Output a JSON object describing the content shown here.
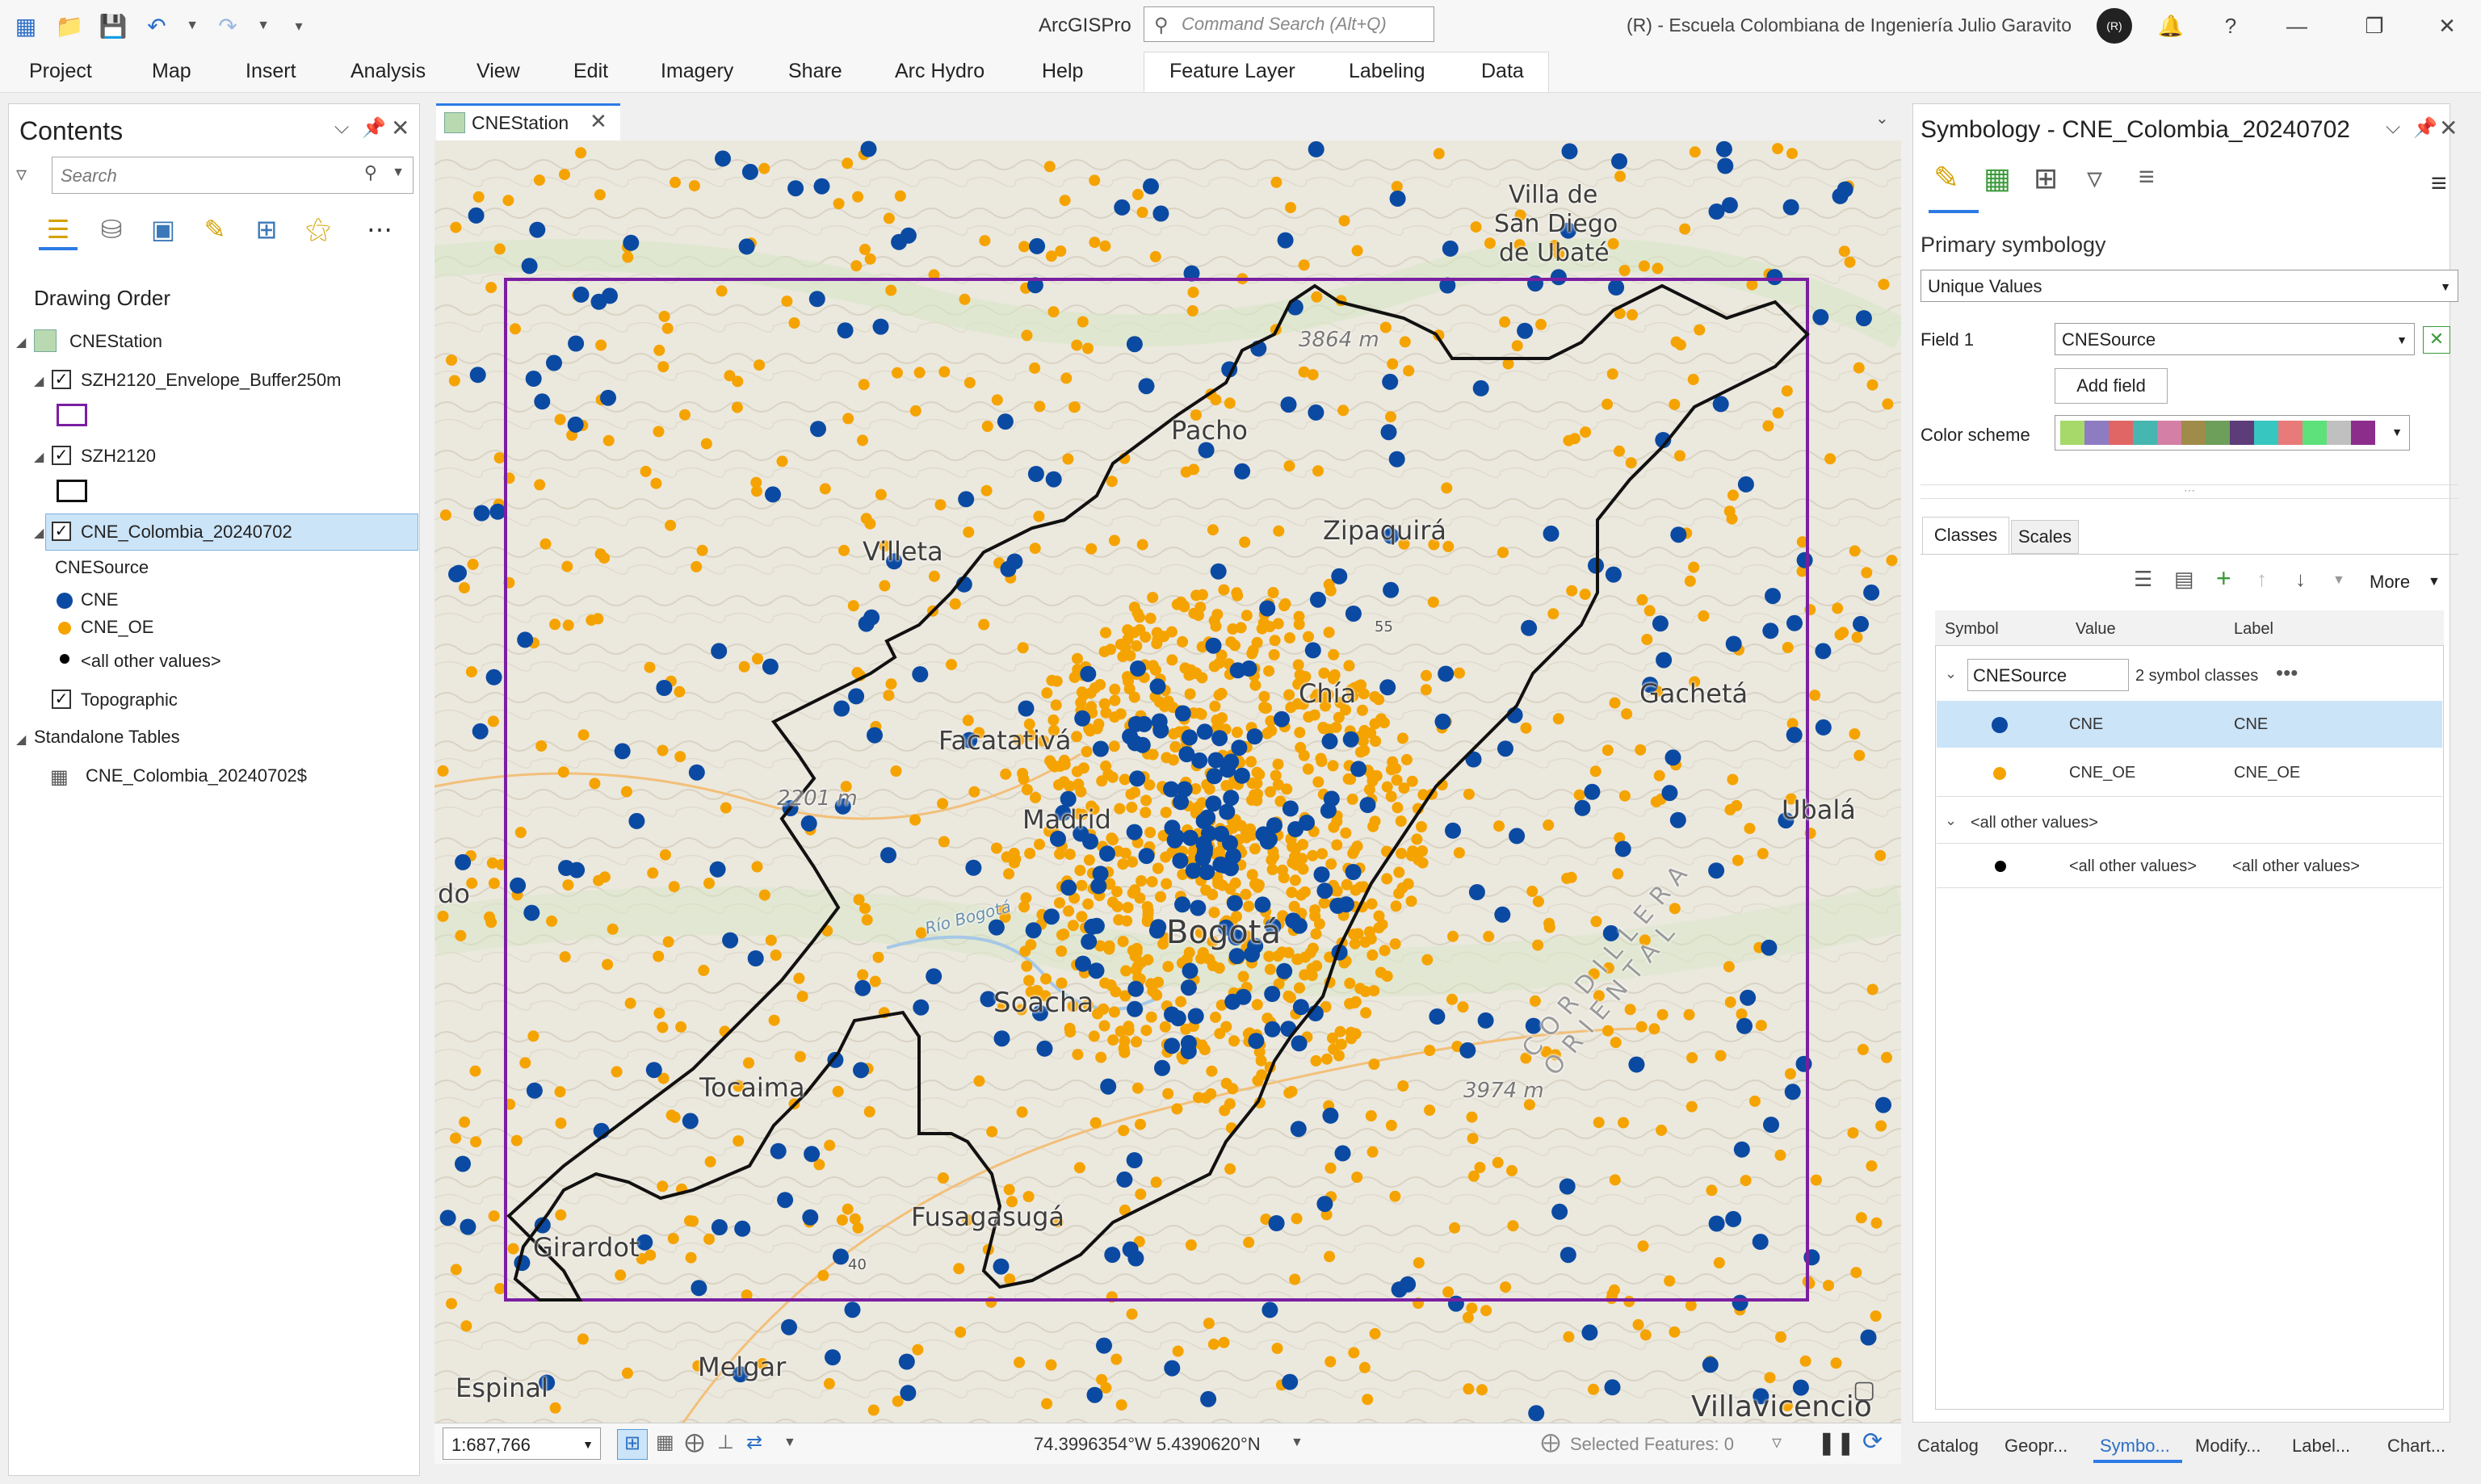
{
  "titlebar": {
    "app_name": "ArcGISPro",
    "search_placeholder": "Command Search (Alt+Q)",
    "organization": "(R) - Escuela Colombiana de Ingeniería Julio Garavito",
    "avatar_initials": "(R)"
  },
  "ribbon": {
    "tabs": [
      "Project",
      "Map",
      "Insert",
      "Analysis",
      "View",
      "Edit",
      "Imagery",
      "Share",
      "Arc Hydro",
      "Help"
    ],
    "context_tabs": [
      "Feature Layer",
      "Labeling",
      "Data"
    ]
  },
  "contents": {
    "title": "Contents",
    "search_placeholder": "Search",
    "drawing_order": "Drawing Order",
    "map_name": "CNEStation",
    "layers": [
      {
        "name": "SZH2120_Envelope_Buffer250m"
      },
      {
        "name": "SZH2120"
      },
      {
        "name": "CNE_Colombia_20240702"
      }
    ],
    "legend_field": "CNESource",
    "legend_items": [
      {
        "label": "CNE",
        "color": "#0b4aa2"
      },
      {
        "label": "CNE_OE",
        "color": "#f5a300"
      },
      {
        "label": "<all other values>",
        "color": "#000000"
      }
    ],
    "basemap": "Topographic",
    "standalone_header": "Standalone Tables",
    "standalone_table": "CNE_Colombia_20240702$"
  },
  "map": {
    "tab_label": "CNEStation",
    "labels": [
      "Villa de",
      "San Diego",
      "de Ubaté",
      "3864 m",
      "Pacho",
      "Zipaquirá",
      "Villeta",
      "Chía",
      "Gachetá",
      "Facatativá",
      "2201 m",
      "Madrid",
      "Ubalá",
      "Bogotá",
      "Soacha",
      "Tocaima",
      "3974 m",
      "Girardot",
      "Fusagasugá",
      "Melgar",
      "Espinal",
      "Villavicencio",
      "do",
      "Río Bogotá",
      "55",
      "40",
      "CORDILLERA ORIENTAL"
    ],
    "cne_color": "#0b4aa2",
    "cne_oe_color": "#f5a300",
    "envelope_color": "#7a1fa2"
  },
  "status": {
    "scale": "1:687,766",
    "coordinates": "74.3996354°W 5.4390620°N",
    "selected_features": "Selected Features: 0"
  },
  "symbology": {
    "title": "Symbology - CNE_Colombia_20240702",
    "primary": "Primary symbology",
    "method": "Unique Values",
    "field_label": "Field 1",
    "field_value": "CNESource",
    "add_field": "Add field",
    "color_scheme_label": "Color scheme",
    "scheme_colors": [
      "#a6d96a",
      "#8e7cc3",
      "#e06666",
      "#45b6b0",
      "#d47fa6",
      "#a08c4a",
      "#6d9e5a",
      "#5c3d7a",
      "#37c6c0",
      "#e87a7a",
      "#5ee07a",
      "#c0c0c0",
      "#8c2d8c"
    ],
    "tabs": [
      "Classes",
      "Scales"
    ],
    "more": "More",
    "columns": [
      "Symbol",
      "Value",
      "Label"
    ],
    "group_name": "CNESource",
    "group_count": "2 symbol classes",
    "classes": [
      {
        "value": "CNE",
        "label": "CNE",
        "color": "#0b4aa2"
      },
      {
        "value": "CNE_OE",
        "label": "CNE_OE",
        "color": "#f5a300"
      }
    ],
    "other_header": "<all other values>",
    "other": {
      "value": "<all other values>",
      "label": "<all other values>",
      "color": "#000000"
    }
  },
  "bottom_tabs": [
    "Catalog",
    "Geopr...",
    "Symbo...",
    "Modify...",
    "Label...",
    "Chart..."
  ]
}
